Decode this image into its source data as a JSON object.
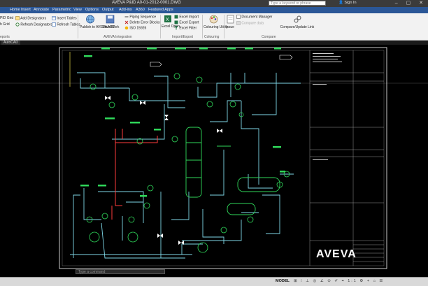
{
  "window": {
    "title": "AVEVA P&ID   A0-01-2012-0001.DWG",
    "search_placeholder": "Type a keyword or phrase",
    "sign_in": "Sign In",
    "controls": "– ▢ ✕"
  },
  "tabs": [
    {
      "label": "Home",
      "active": false
    },
    {
      "label": "Insert",
      "active": false
    },
    {
      "label": "Annotate",
      "active": false
    },
    {
      "label": "Parametric",
      "active": false
    },
    {
      "label": "View",
      "active": false
    },
    {
      "label": "Options",
      "active": false
    },
    {
      "label": "Output",
      "active": false
    },
    {
      "label": "Add-ins",
      "active": false
    },
    {
      "label": "A360",
      "active": false
    },
    {
      "label": "Featured Apps",
      "active": false
    }
  ],
  "ribbon": {
    "pid_grid": "PID Grid",
    "grid": "h Grid",
    "add_designators": "Add Designators",
    "refresh_designators": "Refresh Designators",
    "insert_tables": "Insert Tables",
    "refresh_tables": "Refresh Tables",
    "publish_net": "Publish to AVEVA.NET",
    "save_work": "Save Work",
    "piping_sequence": "Piping Sequence",
    "delete_error_blocks": "Delete Error Blocks",
    "iso_15926": "ISO 15926",
    "excel_open": "Excel Open",
    "excel_import": "Excel Import",
    "excel_export": "Excel Export",
    "excel_filter": "Excel Filter",
    "colouring_utility": "Colouring Utility",
    "issue": "Issue",
    "document_manager": "Document Manager",
    "compare_data": "Compare data",
    "compare_update_link": "Compare/Update Link",
    "groups": {
      "reports": "eports",
      "aveva_integration": "AVEVA Integration",
      "import_export": "Import/Export",
      "colouring": "Colouring",
      "compare": "Compare"
    }
  },
  "document_tab": "AutoCAD",
  "drawing": {
    "logo": "AVEVA"
  },
  "command_line": {
    "placeholder": "Type a command"
  },
  "status": {
    "model": "MODEL",
    "icons": "⊞ ⁞ ⊥ ◎ ∠ ⊙ ✐ ⌖ 1:1 ⚙ + ⌂ ☰"
  },
  "colors": {
    "ribbon_tab_bg": "#2b5797",
    "drawing_bg": "#000000",
    "pipe_cyan": "#7fd8e8",
    "pipe_red": "#ff3b3b",
    "symbol_green": "#2fd85a",
    "frame_white": "#ffffff"
  }
}
